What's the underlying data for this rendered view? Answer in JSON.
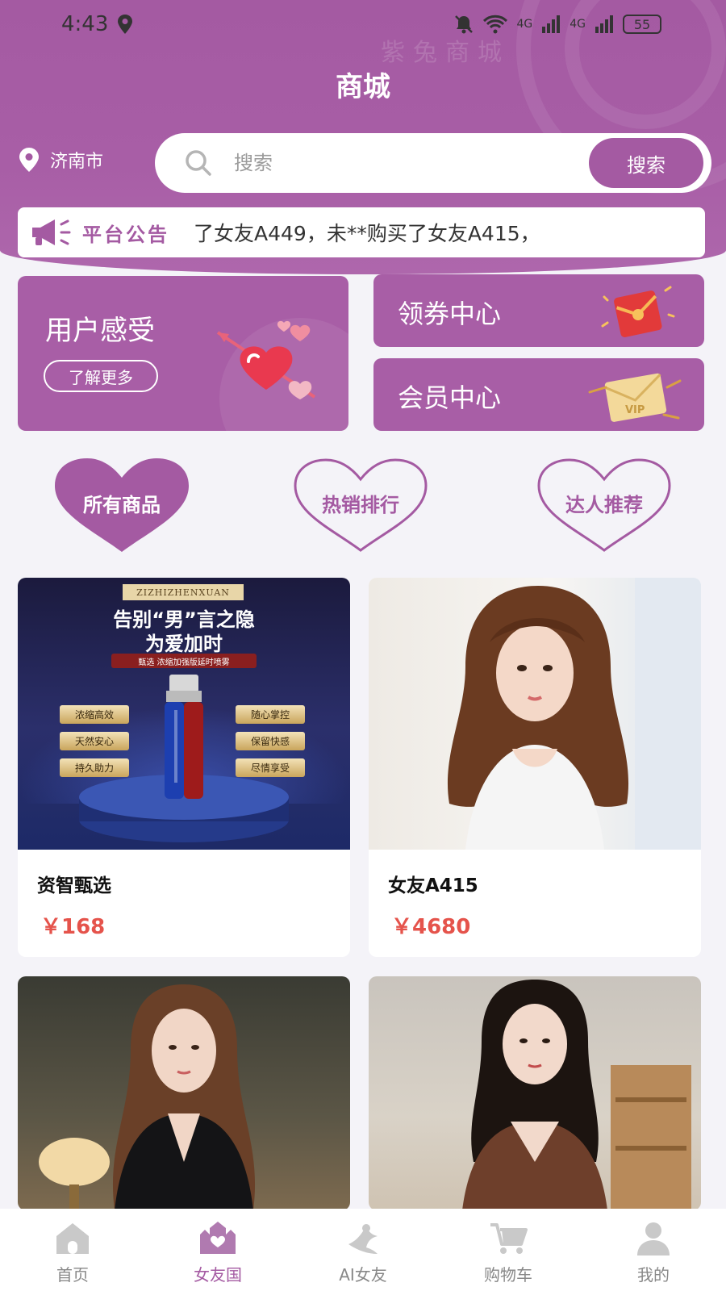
{
  "status_bar": {
    "time": "4:43",
    "battery": "55",
    "network1": "4G",
    "network2": "4G"
  },
  "header": {
    "title": "商城",
    "watermark": "紫兔商城"
  },
  "location": {
    "city": "济南市"
  },
  "search": {
    "placeholder": "搜索",
    "button_label": "搜索"
  },
  "notice": {
    "label": "平台公告",
    "text": "了女友A449，未**购买了女友A415，"
  },
  "promo": {
    "user_experience": {
      "title": "用户感受",
      "button": "了解更多"
    },
    "coupon_center": {
      "title": "领券中心"
    },
    "member_center": {
      "title": "会员中心",
      "vip_text": "VIP"
    }
  },
  "categories": [
    {
      "label": "所有商品",
      "active": true
    },
    {
      "label": "热销排行",
      "active": false
    },
    {
      "label": "达人推荐",
      "active": false
    }
  ],
  "products": [
    {
      "name": "资智甄选",
      "price": "￥168",
      "banner": {
        "brand": "ZIZHIZHENXUAN",
        "headline1": "告别“男”言之隐",
        "headline2": "为爱加时",
        "sub": "甄选 浓缩加强版延时喷雾",
        "tags_left": [
          "浓缩高效",
          "天然安心",
          "持久助力"
        ],
        "tags_right": [
          "随心掌控",
          "保留快感",
          "尽情享受"
        ]
      }
    },
    {
      "name": "女友A415",
      "price": "￥4680"
    },
    {
      "name": "",
      "price": ""
    },
    {
      "name": "",
      "price": ""
    }
  ],
  "tabbar": [
    {
      "label": "首页",
      "icon": "home-icon",
      "active": false
    },
    {
      "label": "女友国",
      "icon": "castle-icon",
      "active": true
    },
    {
      "label": "AI女友",
      "icon": "ai-figure-icon",
      "active": false
    },
    {
      "label": "购物车",
      "icon": "cart-icon",
      "active": false
    },
    {
      "label": "我的",
      "icon": "user-icon",
      "active": false
    }
  ],
  "colors": {
    "brand": "#a45aa2",
    "price": "#e5534b",
    "background": "#f4f3f8"
  }
}
